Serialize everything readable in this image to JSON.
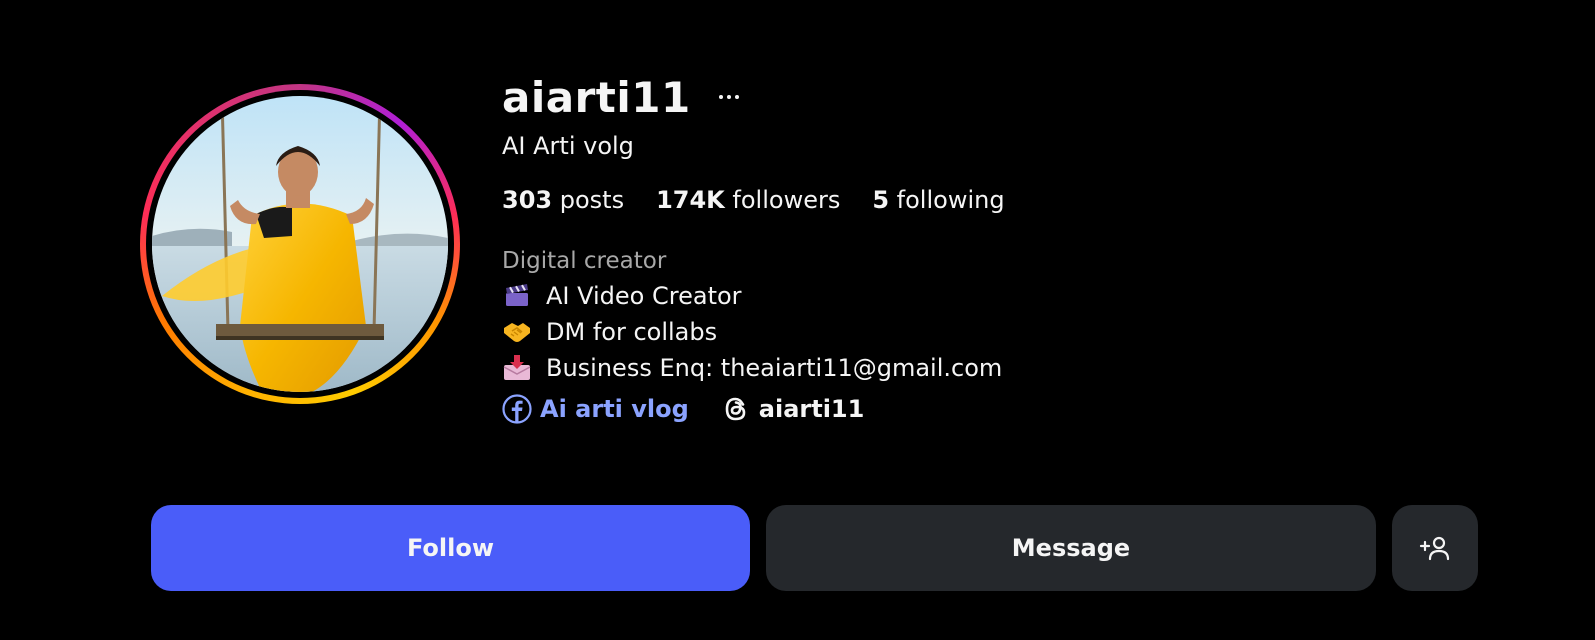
{
  "profile": {
    "username": "aiarti11",
    "full_name": "AI Arti volg",
    "stats": {
      "posts_count": "303",
      "posts_label": " posts",
      "followers_count": "174K",
      "followers_label": " followers",
      "following_count": "5",
      "following_label": " following"
    },
    "category": "Digital creator",
    "bio": [
      {
        "emoji": "clapperboard-icon",
        "text": "AI Video Creator"
      },
      {
        "emoji": "handshake-icon",
        "text": "DM for collabs"
      },
      {
        "emoji": "inbox-tray-icon",
        "text": "Business Enq: theaiarti11@gmail.com"
      }
    ],
    "links": {
      "facebook_label": "Ai arti vlog",
      "threads_label": "aiarti11"
    }
  },
  "actions": {
    "follow_label": "Follow",
    "message_label": "Message"
  },
  "colors": {
    "background": "#000000",
    "follow_button": "#4a5df9",
    "secondary_button": "#25282c",
    "link": "#8ba3ff",
    "muted_text": "#a8a8a8"
  }
}
